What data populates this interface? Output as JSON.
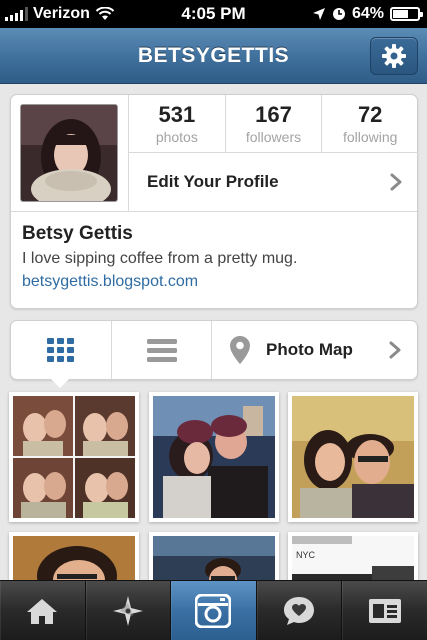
{
  "status_bar": {
    "carrier": "Verizon",
    "time": "4:05 PM",
    "battery": "64%",
    "battery_level": 0.64
  },
  "nav": {
    "title": "BETSYGETTIS",
    "settings_icon": "gear-icon"
  },
  "profile": {
    "stats": [
      {
        "value": "531",
        "label": "photos"
      },
      {
        "value": "167",
        "label": "followers"
      },
      {
        "value": "72",
        "label": "following"
      }
    ],
    "edit_label": "Edit Your Profile",
    "name": "Betsy Gettis",
    "bio": "I love sipping coffee from a pretty mug.",
    "link": "betsygettis.blogspot.com"
  },
  "view_bar": {
    "grid_icon": "grid-view-icon",
    "list_icon": "list-view-icon",
    "map_label": "Photo Map",
    "active": "grid"
  },
  "photos": {
    "thumb_6_caption": "NYC"
  },
  "tabs": [
    {
      "icon": "home-icon",
      "active": false
    },
    {
      "icon": "explore-star-icon",
      "active": false
    },
    {
      "icon": "camera-icon",
      "active": true
    },
    {
      "icon": "activity-heart-bubble-icon",
      "active": false
    },
    {
      "icon": "profile-card-icon",
      "active": false
    }
  ],
  "colors": {
    "nav_blue": "#3f6f9b",
    "link_blue": "#2f6ca3",
    "active_tab": "#3b70a4"
  }
}
